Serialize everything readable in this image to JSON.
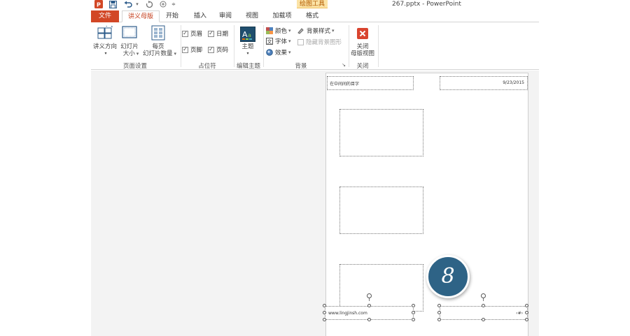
{
  "quick_access": {
    "app_icon": "powerpoint-icon",
    "save_icon": "save-icon",
    "undo_icon": "undo-icon",
    "redo_icon": "redo-icon",
    "customize_icon": "customize-icon"
  },
  "contextual_tab_group": "绘图工具",
  "window_title": "267.pptx - PowerPoint",
  "tabs": {
    "file": "文件",
    "handout_master": "讲义母版",
    "home": "开始",
    "insert": "插入",
    "review": "审阅",
    "view": "视图",
    "addins": "加载项",
    "format": "格式"
  },
  "ribbon": {
    "page_setup": {
      "group_label": "页面设置",
      "orientation_label": "讲义方向",
      "slide_size_label_1": "幻灯片",
      "slide_size_label_2": "大小",
      "per_page_label_1": "每页",
      "per_page_label_2": "幻灯片数量"
    },
    "placeholders": {
      "group_label": "占位符",
      "header": "页眉",
      "date": "日期",
      "footer": "页脚",
      "page_number": "页码"
    },
    "edit_theme": {
      "group_label": "编辑主题",
      "themes_label": "主题"
    },
    "background": {
      "group_label": "背景",
      "colors": "颜色",
      "fonts": "字体",
      "effects": "效果",
      "background_styles": "背景样式",
      "hide_background_graphics": "隐藏背景图形"
    },
    "close": {
      "group_label": "关闭",
      "close_label_1": "关闭",
      "close_label_2": "母版视图"
    }
  },
  "handout": {
    "header_text": "在中间间的目字",
    "date_text": "9/23/2015",
    "footer_text": "www.lingjinsh.com",
    "page_number_text": "‹#›"
  },
  "step_badge": "8",
  "colors": {
    "file_tab": "#d24726",
    "active_tab_text": "#c43e1c",
    "contextual_tab": "#fbe3a6",
    "badge": "#2e6386",
    "close_icon": "#d9442f"
  }
}
